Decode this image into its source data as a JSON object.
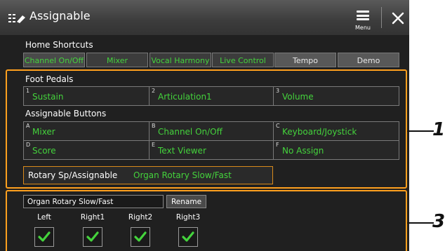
{
  "window": {
    "title": "Assignable",
    "menu_label": "Menu"
  },
  "home_shortcuts": {
    "label": "Home Shortcuts",
    "tabs": [
      "Channel On/Off",
      "Mixer",
      "Vocal Harmony",
      "Live Control",
      "Tempo",
      "Demo"
    ]
  },
  "foot_pedals": {
    "label": "Foot Pedals",
    "items": [
      {
        "num": "1",
        "label": "Sustain"
      },
      {
        "num": "2",
        "label": "Articulation1"
      },
      {
        "num": "3",
        "label": "Volume"
      }
    ]
  },
  "assignable_buttons": {
    "label": "Assignable Buttons",
    "items": [
      {
        "num": "A",
        "label": "Mixer"
      },
      {
        "num": "B",
        "label": "Channel On/Off"
      },
      {
        "num": "C",
        "label": "Keyboard/Joystick"
      },
      {
        "num": "D",
        "label": "Score"
      },
      {
        "num": "E",
        "label": "Text Viewer"
      },
      {
        "num": "F",
        "label": "No Assign"
      }
    ]
  },
  "rotary": {
    "label": "Rotary Sp/Assignable",
    "value": "Organ Rotary Slow/Fast"
  },
  "detail": {
    "name_value": "Organ Rotary Slow/Fast",
    "rename_label": "Rename",
    "checks": [
      {
        "label": "Left",
        "checked": true
      },
      {
        "label": "Right1",
        "checked": true
      },
      {
        "label": "Right2",
        "checked": true
      },
      {
        "label": "Right3",
        "checked": true
      }
    ]
  },
  "callouts": [
    "1",
    "3"
  ],
  "colors": {
    "accent_green": "#44d33c",
    "highlight_orange": "#ffa01e",
    "background": "#202020"
  }
}
